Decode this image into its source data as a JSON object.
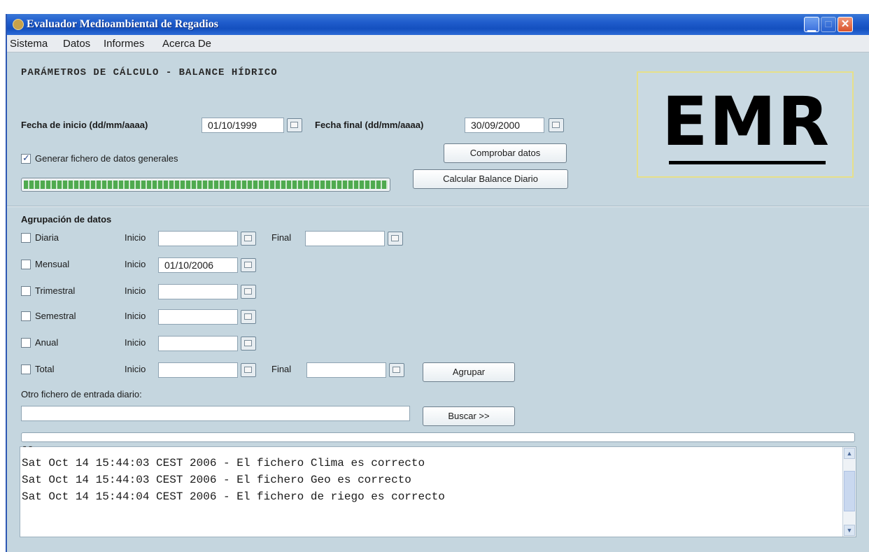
{
  "window": {
    "title": "Evaluador Medioambiental de Regadios"
  },
  "menu": [
    "Sistema",
    "Datos",
    "Informes",
    "Acerca De"
  ],
  "heading": "PARÁMETROS DE CÁLCULO - BALANCE HÍDRICO",
  "dates": {
    "start_label": "Fecha de inicio (dd/mm/aaaa)",
    "start_value": "01/10/1999",
    "end_label": "Fecha final (dd/mm/aaaa)",
    "end_value": "30/09/2000"
  },
  "generate": {
    "label": "Generar fichero de datos generales",
    "checked": true
  },
  "buttons": {
    "check": "Comprobar datos",
    "calc": "Calcular Balance Diario",
    "group": "Agrupar",
    "search": "Buscar >>"
  },
  "progress": {
    "percent": 100
  },
  "logo": {
    "text": "EMR"
  },
  "grouping": {
    "title": "Agrupación de datos",
    "start_label": "Inicio",
    "end_label": "Final",
    "rows": [
      {
        "name": "Diaria",
        "start": "",
        "end": ""
      },
      {
        "name": "Mensual",
        "start": "01/10/2006"
      },
      {
        "name": "Trimestral",
        "start": ""
      },
      {
        "name": "Semestral",
        "start": ""
      },
      {
        "name": "Anual",
        "start": ""
      },
      {
        "name": "Total",
        "start": "",
        "end": ""
      }
    ]
  },
  "other_file": {
    "label": "Otro fichero de entrada diario:",
    "value": ""
  },
  "log": {
    "dash": "--",
    "lines": [
      "Sat Oct 14 15:44:03 CEST 2006 - El fichero Clima es correcto",
      "Sat Oct 14 15:44:03 CEST 2006 - El fichero Geo es correcto",
      "Sat Oct 14 15:44:04 CEST 2006 - El fichero de riego es correcto"
    ]
  }
}
